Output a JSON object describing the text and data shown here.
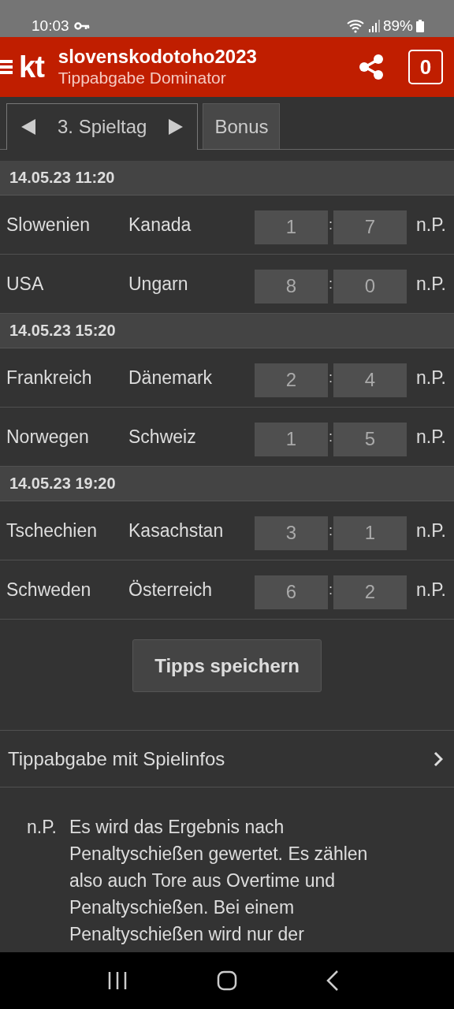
{
  "status_bar": {
    "time": "10:03",
    "battery": "89%"
  },
  "header": {
    "logo": "kt",
    "title": "slovenskodotoho2023",
    "subtitle": "Tippabgabe Dominator",
    "badge": "0"
  },
  "tabs": [
    {
      "label": "3. Spieltag",
      "selected": true,
      "arrows": true
    },
    {
      "label": "Bonus",
      "selected": false,
      "arrows": false
    }
  ],
  "groups": [
    {
      "date": "14.05.23 11:20",
      "matches": [
        {
          "home": "Slowenien",
          "away": "Kanada",
          "home_score": "1",
          "separator": ":",
          "away_score": "7",
          "note": "n.P."
        },
        {
          "home": "USA",
          "away": "Ungarn",
          "home_score": "8",
          "separator": ":",
          "away_score": "0",
          "note": "n.P."
        }
      ]
    },
    {
      "date": "14.05.23 15:20",
      "matches": [
        {
          "home": "Frankreich",
          "away": "Dänemark",
          "home_score": "2",
          "separator": ":",
          "away_score": "4",
          "note": "n.P."
        },
        {
          "home": "Norwegen",
          "away": "Schweiz",
          "home_score": "1",
          "separator": ":",
          "away_score": "5",
          "note": "n.P."
        }
      ]
    },
    {
      "date": "14.05.23 19:20",
      "matches": [
        {
          "home": "Tschechien",
          "away": "Kasachstan",
          "home_score": "3",
          "separator": ":",
          "away_score": "1",
          "note": "n.P."
        },
        {
          "home": "Schweden",
          "away": "Österreich",
          "home_score": "6",
          "separator": ":",
          "away_score": "2",
          "note": "n.P."
        }
      ]
    }
  ],
  "save_button": "Tipps speichern",
  "info_link": "Tippabgabe mit Spielinfos",
  "footnote": {
    "mark": "n.P.",
    "text": "Es wird das Ergebnis nach Penaltyschießen gewertet. Es zählen also auch Tore aus Overtime und Penaltyschießen. Bei einem Penaltyschießen wird nur der"
  }
}
